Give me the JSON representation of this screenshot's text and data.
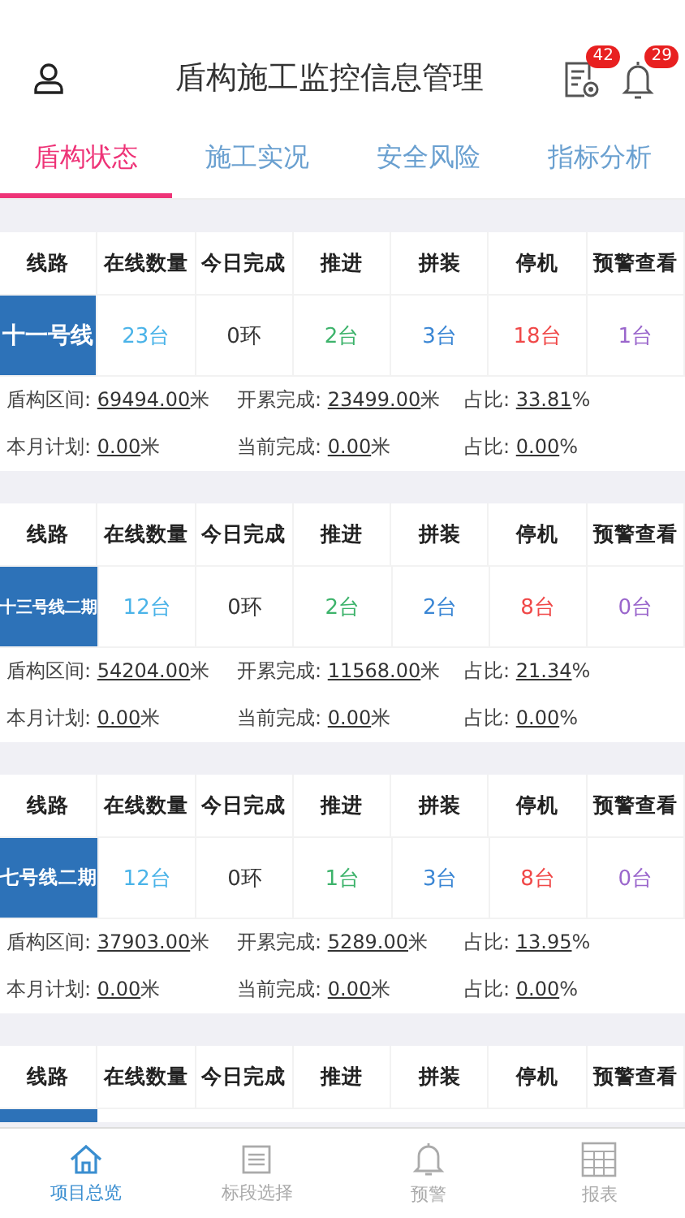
{
  "header": {
    "title": "盾构施工监控信息管理",
    "badges": [
      {
        "kind": "report",
        "count": "42"
      },
      {
        "kind": "bell",
        "count": "29"
      }
    ]
  },
  "tabs": [
    {
      "label": "盾构状态",
      "selected": true
    },
    {
      "label": "施工实况",
      "selected": false
    },
    {
      "label": "安全风险",
      "selected": false
    },
    {
      "label": "指标分析",
      "selected": false
    }
  ],
  "cards": [
    {
      "columns": [
        "线路",
        "在线数量",
        "今日完成",
        "推进",
        "拼装",
        "停机",
        "预警查看"
      ],
      "line": "十一号线",
      "values": [
        {
          "text": "23台",
          "color": "#4ab3e8"
        },
        {
          "text": "0环",
          "color": "#333333"
        },
        {
          "text": "2台",
          "color": "#3db36b"
        },
        {
          "text": "3台",
          "color": "#3a86d4"
        },
        {
          "text": "18台",
          "color": "#f04848"
        },
        {
          "text": "1台",
          "color": "#9a66cc"
        }
      ],
      "stats": [
        [
          {
            "label": "盾构区间:",
            "value": "69494.00",
            "unit": "米"
          },
          {
            "label": "开累完成:",
            "value": "23499.00",
            "unit": "米"
          },
          {
            "label": "占比:",
            "value": "33.81",
            "unit": "%"
          }
        ],
        [
          {
            "label": "本月计划:",
            "value": "0.00",
            "unit": "米"
          },
          {
            "label": "当前完成:",
            "value": "0.00",
            "unit": "米"
          },
          {
            "label": "占比:",
            "value": "0.00",
            "unit": "%"
          }
        ]
      ]
    },
    {
      "columns": [
        "线路",
        "在线数量",
        "今日完成",
        "推进",
        "拼装",
        "停机",
        "预警查看"
      ],
      "line": "十三号线二期",
      "values": [
        {
          "text": "12台",
          "color": "#4ab3e8"
        },
        {
          "text": "0环",
          "color": "#333333"
        },
        {
          "text": "2台",
          "color": "#3db36b"
        },
        {
          "text": "2台",
          "color": "#3a86d4"
        },
        {
          "text": "8台",
          "color": "#f04848"
        },
        {
          "text": "0台",
          "color": "#9a66cc"
        }
      ],
      "stats": [
        [
          {
            "label": "盾构区间:",
            "value": "54204.00",
            "unit": "米"
          },
          {
            "label": "开累完成:",
            "value": "11568.00",
            "unit": "米"
          },
          {
            "label": "占比:",
            "value": "21.34",
            "unit": "%"
          }
        ],
        [
          {
            "label": "本月计划:",
            "value": "0.00",
            "unit": "米"
          },
          {
            "label": "当前完成:",
            "value": "0.00",
            "unit": "米"
          },
          {
            "label": "占比:",
            "value": "0.00",
            "unit": "%"
          }
        ]
      ]
    },
    {
      "columns": [
        "线路",
        "在线数量",
        "今日完成",
        "推进",
        "拼装",
        "停机",
        "预警查看"
      ],
      "line": "七号线二期",
      "values": [
        {
          "text": "12台",
          "color": "#4ab3e8"
        },
        {
          "text": "0环",
          "color": "#333333"
        },
        {
          "text": "1台",
          "color": "#3db36b"
        },
        {
          "text": "3台",
          "color": "#3a86d4"
        },
        {
          "text": "8台",
          "color": "#f04848"
        },
        {
          "text": "0台",
          "color": "#9a66cc"
        }
      ],
      "stats": [
        [
          {
            "label": "盾构区间:",
            "value": "37903.00",
            "unit": "米"
          },
          {
            "label": "开累完成:",
            "value": "5289.00",
            "unit": "米"
          },
          {
            "label": "占比:",
            "value": "13.95",
            "unit": "%"
          }
        ],
        [
          {
            "label": "本月计划:",
            "value": "0.00",
            "unit": "米"
          },
          {
            "label": "当前完成:",
            "value": "0.00",
            "unit": "米"
          },
          {
            "label": "占比:",
            "value": "0.00",
            "unit": "%"
          }
        ]
      ]
    },
    {
      "columns": [
        "线路",
        "在线数量",
        "今日完成",
        "推进",
        "拼装",
        "停机",
        "预警查看"
      ]
    }
  ],
  "nav": [
    {
      "kind": "home",
      "label": "项目总览",
      "selected": true
    },
    {
      "kind": "list",
      "label": "标段选择",
      "selected": false
    },
    {
      "kind": "bell",
      "label": "预警",
      "selected": false
    },
    {
      "kind": "table",
      "label": "报表",
      "selected": false
    }
  ]
}
